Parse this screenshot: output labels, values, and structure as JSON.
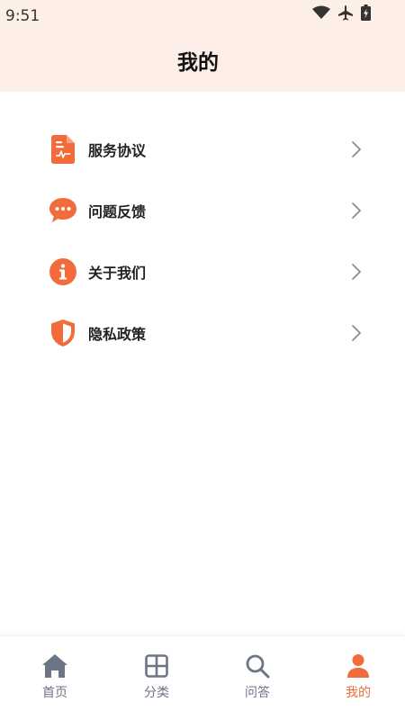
{
  "status_bar": {
    "time": "9:51",
    "icons": [
      "wifi-icon",
      "airplane-icon",
      "battery-charging-icon"
    ]
  },
  "header": {
    "title": "我的"
  },
  "menu": {
    "items": [
      {
        "label": "服务协议",
        "icon": "document-icon"
      },
      {
        "label": "问题反馈",
        "icon": "chat-bubble-icon"
      },
      {
        "label": "关于我们",
        "icon": "info-icon"
      },
      {
        "label": "隐私政策",
        "icon": "shield-icon"
      }
    ]
  },
  "bottom_nav": {
    "items": [
      {
        "label": "首页",
        "icon": "home-icon"
      },
      {
        "label": "分类",
        "icon": "grid-icon"
      },
      {
        "label": "问答",
        "icon": "search-icon"
      },
      {
        "label": "我的",
        "icon": "person-icon"
      }
    ],
    "active_index": 3
  },
  "colors": {
    "accent": "#f26b3a",
    "header_bg": "#fdeee7",
    "nav_inactive": "#6b7586"
  }
}
